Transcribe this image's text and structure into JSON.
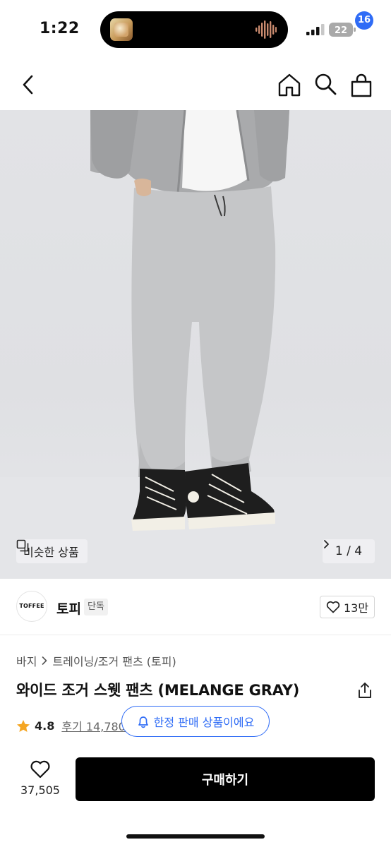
{
  "status_bar": {
    "time": "1:22",
    "battery": "22"
  },
  "nav": {
    "cart_badge": "16"
  },
  "hero": {
    "similar_label": "비슷한 상품",
    "page_indicator": "1 / 4",
    "page_current": 1,
    "page_total": 4
  },
  "brand": {
    "logo_text": "TOFFEE",
    "name": "토피",
    "tag": "단독",
    "likes": "13만"
  },
  "product": {
    "breadcrumb": [
      "바지",
      "트레이닝/조거 팬츠 (토피)"
    ],
    "title": "와이드 조거 스웻 팬츠 (MELANGE GRAY)",
    "rating": "4.8",
    "reviews": "후기 14,780"
  },
  "toast": {
    "text": "한정 판매 상품이에요"
  },
  "bottom_bar": {
    "wish_count": "37,505",
    "buy_label": "구매하기"
  },
  "colors": {
    "accent_blue": "#2f6cf6",
    "star": "#f5a623",
    "buy_button": "#000000"
  },
  "icons": [
    "back-icon",
    "home-icon",
    "search-icon",
    "cart-icon",
    "similar-icon",
    "chevron-right-icon",
    "heart-icon",
    "share-icon",
    "star-icon",
    "bell-icon"
  ]
}
